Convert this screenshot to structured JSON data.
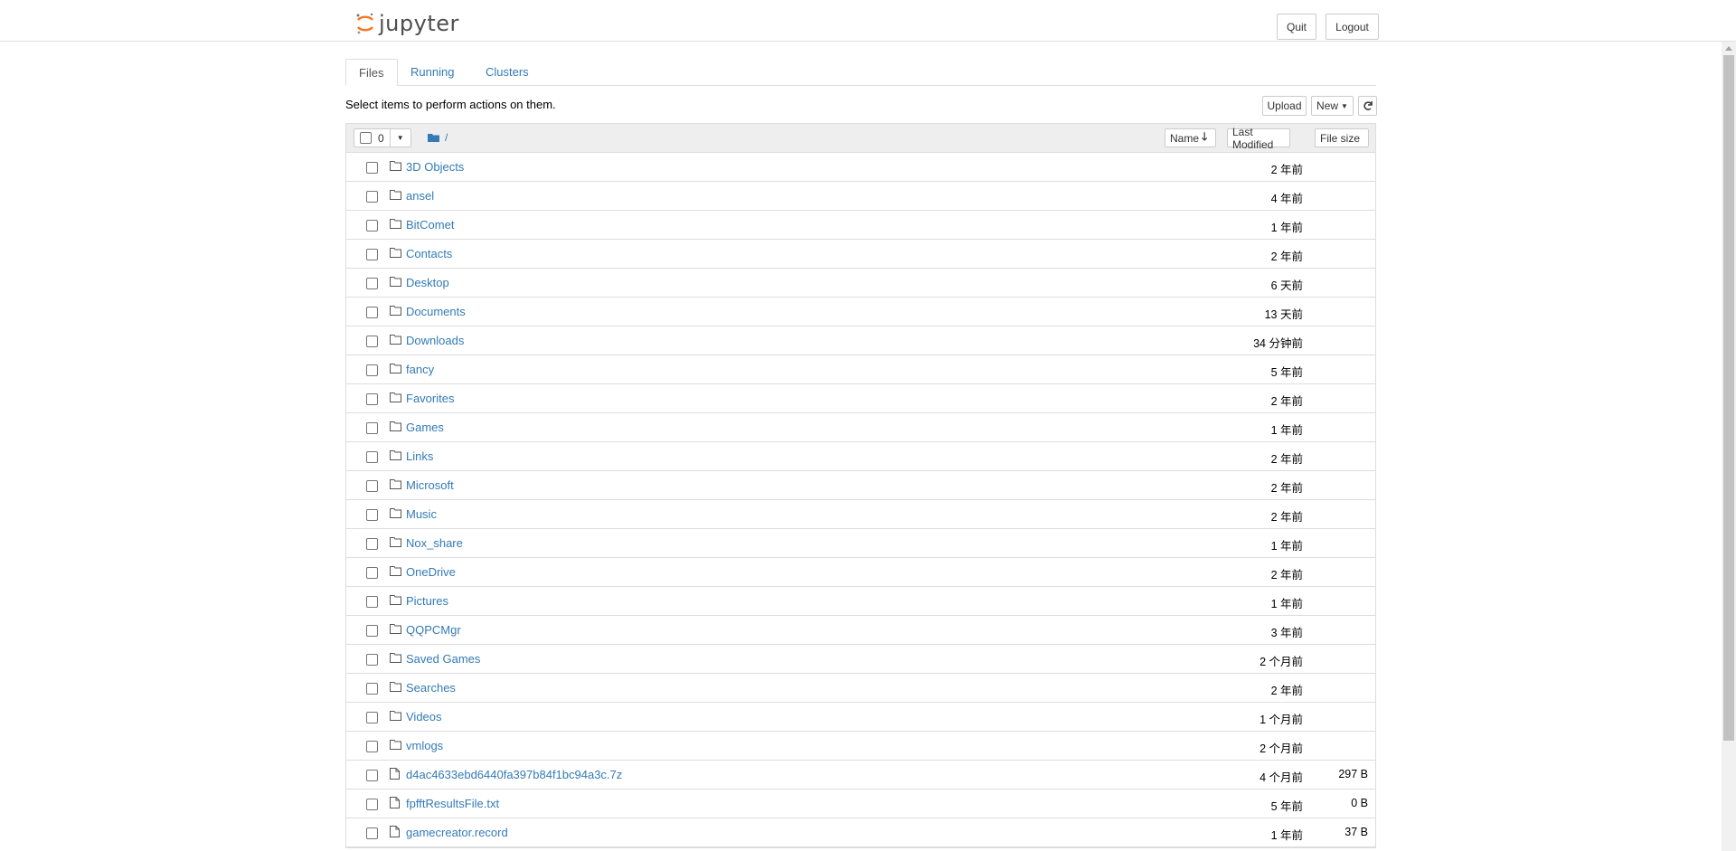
{
  "app": {
    "logo_text": "jupyter"
  },
  "header": {
    "quit_label": "Quit",
    "logout_label": "Logout"
  },
  "tabs": [
    {
      "label": "Files"
    },
    {
      "label": "Running"
    },
    {
      "label": "Clusters"
    }
  ],
  "toolbar": {
    "hint": "Select items to perform actions on them.",
    "upload_label": "Upload",
    "new_label": "New",
    "selected_count": "0"
  },
  "breadcrumb": {
    "path": "/"
  },
  "columns": {
    "name_label": "Name",
    "modified_label": "Last Modified",
    "size_label": "File size"
  },
  "colors": {
    "link": "#337ab7",
    "accent_logo": "#f37726"
  },
  "files": [
    {
      "name": "3D Objects",
      "modified": "2 年前",
      "size": "",
      "type": "folder"
    },
    {
      "name": "ansel",
      "modified": "4 年前",
      "size": "",
      "type": "folder"
    },
    {
      "name": "BitComet",
      "modified": "1 年前",
      "size": "",
      "type": "folder"
    },
    {
      "name": "Contacts",
      "modified": "2 年前",
      "size": "",
      "type": "folder"
    },
    {
      "name": "Desktop",
      "modified": "6 天前",
      "size": "",
      "type": "folder"
    },
    {
      "name": "Documents",
      "modified": "13 天前",
      "size": "",
      "type": "folder"
    },
    {
      "name": "Downloads",
      "modified": "34 分钟前",
      "size": "",
      "type": "folder"
    },
    {
      "name": "fancy",
      "modified": "5 年前",
      "size": "",
      "type": "folder"
    },
    {
      "name": "Favorites",
      "modified": "2 年前",
      "size": "",
      "type": "folder"
    },
    {
      "name": "Games",
      "modified": "1 年前",
      "size": "",
      "type": "folder"
    },
    {
      "name": "Links",
      "modified": "2 年前",
      "size": "",
      "type": "folder"
    },
    {
      "name": "Microsoft",
      "modified": "2 年前",
      "size": "",
      "type": "folder"
    },
    {
      "name": "Music",
      "modified": "2 年前",
      "size": "",
      "type": "folder"
    },
    {
      "name": "Nox_share",
      "modified": "1 年前",
      "size": "",
      "type": "folder"
    },
    {
      "name": "OneDrive",
      "modified": "2 年前",
      "size": "",
      "type": "folder"
    },
    {
      "name": "Pictures",
      "modified": "1 年前",
      "size": "",
      "type": "folder"
    },
    {
      "name": "QQPCMgr",
      "modified": "3 年前",
      "size": "",
      "type": "folder"
    },
    {
      "name": "Saved Games",
      "modified": "2 个月前",
      "size": "",
      "type": "folder"
    },
    {
      "name": "Searches",
      "modified": "2 年前",
      "size": "",
      "type": "folder"
    },
    {
      "name": "Videos",
      "modified": "1 个月前",
      "size": "",
      "type": "folder"
    },
    {
      "name": "vmlogs",
      "modified": "2 个月前",
      "size": "",
      "type": "folder"
    },
    {
      "name": "d4ac4633ebd6440fa397b84f1bc94a3c.7z",
      "modified": "4 个月前",
      "size": "297 B",
      "type": "file"
    },
    {
      "name": "fpfftResultsFile.txt",
      "modified": "5 年前",
      "size": "0 B",
      "type": "file"
    },
    {
      "name": "gamecreator.record",
      "modified": "1 年前",
      "size": "37 B",
      "type": "file"
    }
  ]
}
